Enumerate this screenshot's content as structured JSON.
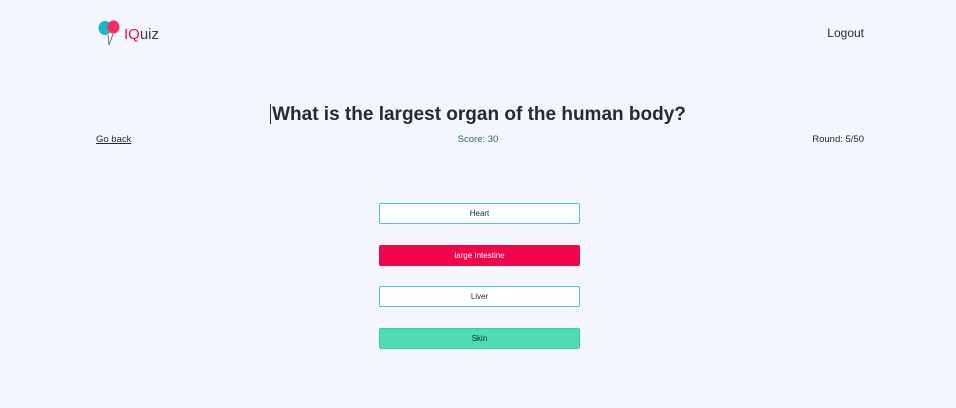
{
  "header": {
    "logo_prefix": "IQ",
    "logo_suffix": "uiz",
    "logo_icon": "balloons-icon",
    "logout_label": "Logout"
  },
  "quiz": {
    "question": "What is the largest organ of the human body?",
    "go_back_label": "Go back",
    "score_text": "Score: 30",
    "round_text": "Round: 5/50",
    "answers": [
      {
        "label": "Heart",
        "state": "default"
      },
      {
        "label": "large Intestine",
        "state": "wrong"
      },
      {
        "label": "Liver",
        "state": "default"
      },
      {
        "label": "Skin",
        "state": "correct"
      }
    ]
  },
  "colors": {
    "background": "#f4f6fd",
    "accent_teal": "#4fc6cf",
    "wrong": "#f2054a",
    "correct": "#4edcb2",
    "score_text": "#1e6b72",
    "logo_pink": "#e8104f"
  }
}
